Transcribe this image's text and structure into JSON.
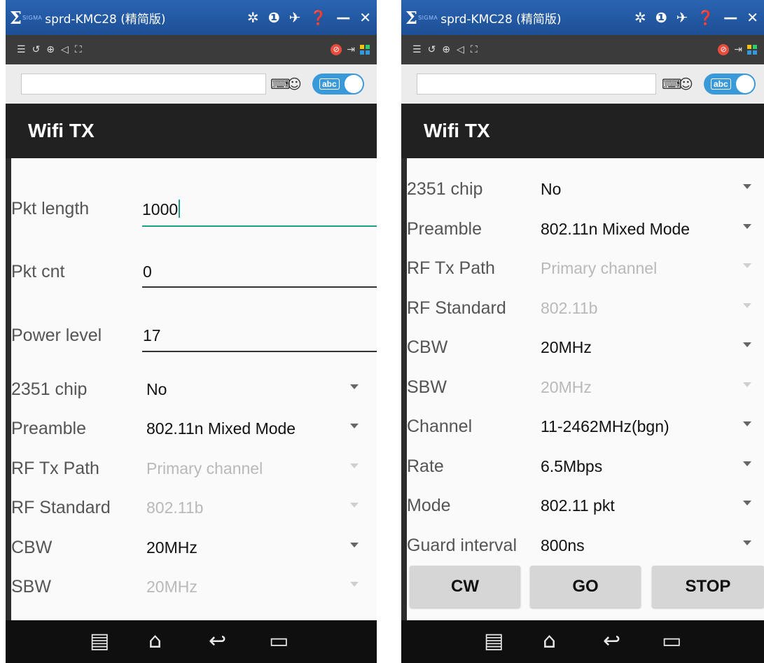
{
  "colors": {
    "titlebar": "#2a64b3",
    "toolbar": "#3b3b3b",
    "appbar": "#212121",
    "focus_underline": "#1aa08a",
    "toggle": "#3a9ad9",
    "disabled_text": "#b9b9b9"
  },
  "window": {
    "logo": "Σ",
    "logo_sub": "SIGMA",
    "title": "sprd-KMC28 (精简版)",
    "title_icons": [
      "gear-icon",
      "info-icon",
      "pin-icon",
      "help-icon",
      "minimize-icon",
      "close-icon"
    ],
    "toolbar_icons": [
      "menu-icon",
      "rotate-icon",
      "zoom-icon",
      "volume-icon",
      "fullscreen-icon"
    ],
    "toolbar_right_icons": [
      "block-icon",
      "exit-icon",
      "apps-grid-icon"
    ],
    "input_value": "",
    "input_icons": [
      "keyboard-icon",
      "emoji-icon"
    ],
    "toggle_label": "abc",
    "toggle_on": true
  },
  "left": {
    "app_title": "Wifi TX",
    "edit_fields": [
      {
        "label": "Pkt length",
        "value": "1000",
        "focused": true
      },
      {
        "label": "Pkt cnt",
        "value": "0",
        "focused": false
      },
      {
        "label": "Power level",
        "value": "17",
        "focused": false
      }
    ],
    "spinners": [
      {
        "label": "2351 chip",
        "value": "No",
        "enabled": true
      },
      {
        "label": "Preamble",
        "value": "802.11n Mixed Mode",
        "enabled": true
      },
      {
        "label": "RF Tx Path",
        "value": "Primary channel",
        "enabled": false
      },
      {
        "label": "RF Standard",
        "value": "802.11b",
        "enabled": false
      },
      {
        "label": "CBW",
        "value": "20MHz",
        "enabled": true
      },
      {
        "label": "SBW",
        "value": "20MHz",
        "enabled": false
      }
    ]
  },
  "right": {
    "app_title": "Wifi TX",
    "spinners": [
      {
        "label": "2351 chip",
        "value": "No",
        "enabled": true
      },
      {
        "label": "Preamble",
        "value": "802.11n Mixed Mode",
        "enabled": true
      },
      {
        "label": "RF Tx Path",
        "value": "Primary channel",
        "enabled": false
      },
      {
        "label": "RF Standard",
        "value": "802.11b",
        "enabled": false
      },
      {
        "label": "CBW",
        "value": "20MHz",
        "enabled": true
      },
      {
        "label": "SBW",
        "value": "20MHz",
        "enabled": false
      },
      {
        "label": "Channel",
        "value": "11-2462MHz(bgn)",
        "enabled": true
      },
      {
        "label": "Rate",
        "value": "6.5Mbps",
        "enabled": true
      },
      {
        "label": "Mode",
        "value": "802.11 pkt",
        "enabled": true
      },
      {
        "label": "Guard interval",
        "value": "800ns",
        "enabled": true
      }
    ],
    "buttons": {
      "cw": "CW",
      "go": "GO",
      "stop": "STOP"
    }
  },
  "navbar": [
    "recent-apps-icon",
    "home-icon",
    "back-icon",
    "overview-icon"
  ]
}
